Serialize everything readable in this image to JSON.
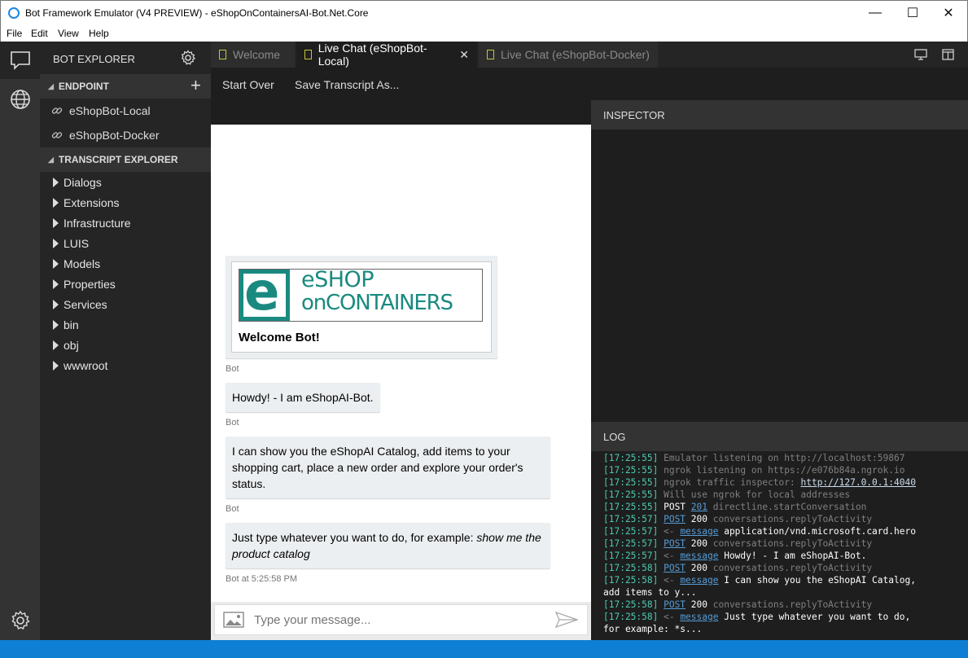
{
  "window": {
    "title": "Bot Framework Emulator (V4 PREVIEW) - eShopOnContainersAI-Bot.Net.Core"
  },
  "menu": [
    "File",
    "Edit",
    "View",
    "Help"
  ],
  "explorer": {
    "title": "BOT EXPLORER",
    "endpoint_section": "ENDPOINT",
    "endpoints": [
      "eShopBot-Local",
      "eShopBot-Docker"
    ],
    "transcript_section": "TRANSCRIPT EXPLORER",
    "folders": [
      "Dialogs",
      "Extensions",
      "Infrastructure",
      "LUIS",
      "Models",
      "Properties",
      "Services",
      "bin",
      "obj",
      "wwwroot"
    ]
  },
  "tabs": [
    {
      "label": "Welcome",
      "active": false
    },
    {
      "label": "Live Chat (eShopBot-Local)",
      "active": true,
      "closable": true
    },
    {
      "label": "Live Chat (eShopBot-Docker)",
      "active": false
    }
  ],
  "toolbar": {
    "start_over": "Start Over",
    "save_transcript": "Save Transcript As..."
  },
  "chat": {
    "card": {
      "logo_line1": "eSHOP",
      "logo_line2": "onCONTAINERS",
      "title": "Welcome Bot!"
    },
    "messages": [
      {
        "text": "Howdy! - I am eShopAI-Bot.",
        "sender": "Bot"
      },
      {
        "text": "I can show you the eShopAI Catalog, add items to your shopping cart, place a new order and explore your order's status.",
        "sender": "Bot"
      },
      {
        "text_plain": "Just type whatever you want to do, for example: ",
        "text_italic": "show me the product catalog",
        "sender": "Bot at 5:25:58 PM"
      }
    ],
    "card_sender": "Bot",
    "input_placeholder": "Type your message..."
  },
  "inspector": {
    "title": "INSPECTOR"
  },
  "log": {
    "title": "LOG",
    "lines": [
      {
        "ts": "17:25:55",
        "parts": [
          {
            "c": "dim",
            "t": "Emulator listening on http://localhost:59867"
          }
        ]
      },
      {
        "ts": "17:25:55",
        "parts": [
          {
            "c": "dim",
            "t": "ngrok listening on https://e076b84a.ngrok.io"
          }
        ]
      },
      {
        "ts": "17:25:55",
        "parts": [
          {
            "c": "dim",
            "t": "ngrok traffic inspector: "
          },
          {
            "c": "lnkw",
            "t": "http://127.0.0.1:4040"
          }
        ]
      },
      {
        "ts": "17:25:55",
        "parts": [
          {
            "c": "dim",
            "t": "Will use ngrok for local addresses"
          }
        ]
      },
      {
        "ts": "17:25:55",
        "parts": [
          {
            "c": "wht",
            "t": "POST "
          },
          {
            "c": "lnk",
            "t": "201"
          },
          {
            "c": "dim",
            "t": " directline.startConversation"
          }
        ]
      },
      {
        "ts": "17:25:57",
        "parts": [
          {
            "c": "lnk",
            "t": "POST"
          },
          {
            "c": "wht",
            "t": " 200 "
          },
          {
            "c": "dim",
            "t": "conversations.replyToActivity"
          }
        ]
      },
      {
        "ts": "17:25:57",
        "parts": [
          {
            "c": "dim",
            "t": "<- "
          },
          {
            "c": "lnk",
            "t": "message"
          },
          {
            "c": "wht",
            "t": " application/vnd.microsoft.card.hero"
          }
        ]
      },
      {
        "ts": "17:25:57",
        "parts": [
          {
            "c": "lnk",
            "t": "POST"
          },
          {
            "c": "wht",
            "t": " 200 "
          },
          {
            "c": "dim",
            "t": "conversations.replyToActivity"
          }
        ]
      },
      {
        "ts": "17:25:57",
        "parts": [
          {
            "c": "dim",
            "t": "<- "
          },
          {
            "c": "lnk",
            "t": "message"
          },
          {
            "c": "wht",
            "t": " Howdy! - I am eShopAI-Bot."
          }
        ]
      },
      {
        "ts": "17:25:58",
        "parts": [
          {
            "c": "lnk",
            "t": "POST"
          },
          {
            "c": "wht",
            "t": " 200 "
          },
          {
            "c": "dim",
            "t": "conversations.replyToActivity"
          }
        ]
      },
      {
        "ts": "17:25:58",
        "parts": [
          {
            "c": "dim",
            "t": "<- "
          },
          {
            "c": "lnk",
            "t": "message"
          },
          {
            "c": "wht",
            "t": " I can show you the eShopAI Catalog,"
          }
        ]
      },
      {
        "ts": "",
        "parts": [
          {
            "c": "wht",
            "t": "add items to y..."
          }
        ]
      },
      {
        "ts": "17:25:58",
        "parts": [
          {
            "c": "lnk",
            "t": "POST"
          },
          {
            "c": "wht",
            "t": " 200 "
          },
          {
            "c": "dim",
            "t": "conversations.replyToActivity"
          }
        ]
      },
      {
        "ts": "17:25:58",
        "parts": [
          {
            "c": "dim",
            "t": "<- "
          },
          {
            "c": "lnk",
            "t": "message"
          },
          {
            "c": "wht",
            "t": " Just type whatever you want to do,"
          }
        ]
      },
      {
        "ts": "",
        "parts": [
          {
            "c": "wht",
            "t": "for example: *s..."
          }
        ]
      }
    ]
  },
  "colors": {
    "accent": "#0e7fd3",
    "teal": "#1a8a80",
    "ts": "#4ec9b0"
  }
}
